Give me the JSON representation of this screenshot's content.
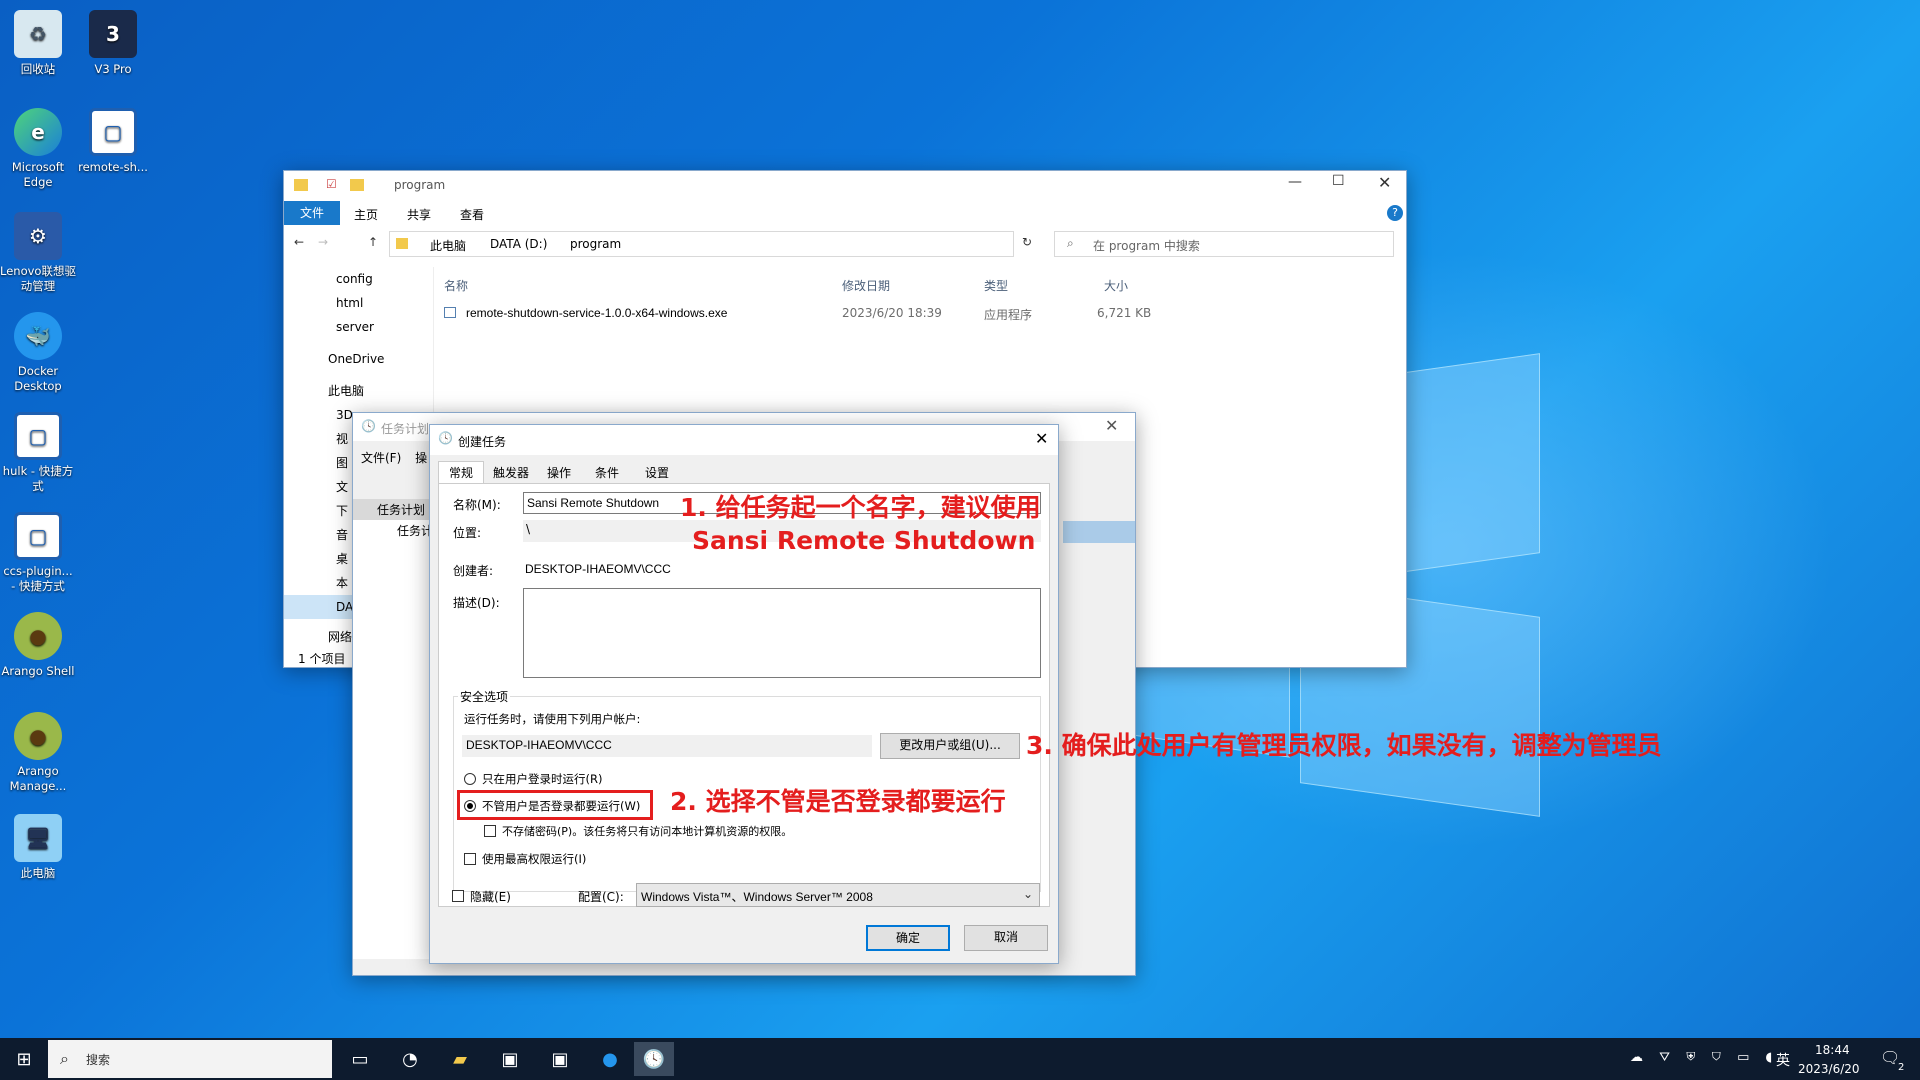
{
  "desktop": {
    "icons": [
      {
        "label": "回收站",
        "icon": "recycle-bin-icon"
      },
      {
        "label": "V3 Pro",
        "icon": "v3-pro-icon"
      },
      {
        "label": "Microsoft Edge",
        "icon": "edge-icon"
      },
      {
        "label": "remote-sh...",
        "icon": "app-icon"
      },
      {
        "label": "Lenovo联想驱动管理",
        "icon": "lenovo-driver-icon"
      },
      {
        "label": "Docker Desktop",
        "icon": "docker-icon"
      },
      {
        "label": "hulk - 快捷方式",
        "icon": "shortcut-icon"
      },
      {
        "label": "ccs-plugin... - 快捷方式",
        "icon": "shortcut-icon"
      },
      {
        "label": "Arango Shell",
        "icon": "avocado-icon"
      },
      {
        "label": "Arango Manage...",
        "icon": "avocado-icon"
      },
      {
        "label": "此电脑",
        "icon": "computer-icon"
      }
    ]
  },
  "explorer": {
    "title": "program",
    "ribbon_tabs": [
      "文件",
      "主页",
      "共享",
      "查看"
    ],
    "breadcrumb": [
      "此电脑",
      "DATA (D:)",
      "program"
    ],
    "search_placeholder": "在 program 中搜索",
    "sidebar": [
      "config",
      "html",
      "server",
      "OneDrive",
      "此电脑",
      "3D",
      "视",
      "图",
      "文",
      "下",
      "音",
      "桌",
      "本",
      "DA",
      "网络"
    ],
    "columns": [
      "名称",
      "修改日期",
      "类型",
      "大小"
    ],
    "rows": [
      {
        "name": "remote-shutdown-service-1.0.0-x64-windows.exe",
        "date": "2023/6/20 18:39",
        "type": "应用程序",
        "size": "6,721 KB"
      }
    ],
    "status": "1 个项目"
  },
  "scheduler": {
    "title": "任务计划",
    "menu": [
      "文件(F)",
      "操"
    ],
    "tree": [
      "任务计划",
      "任务计"
    ]
  },
  "dialog": {
    "title": "创建任务",
    "tabs": [
      "常规",
      "触发器",
      "操作",
      "条件",
      "设置"
    ],
    "name_label": "名称(M):",
    "name_value": "Sansi Remote Shutdown",
    "location_label": "位置:",
    "location_value": "\\",
    "author_label": "创建者:",
    "author_value": "DESKTOP-IHAEOMV\\CCC",
    "desc_label": "描述(D):",
    "security_group": "安全选项",
    "run_as_text": "运行任务时，请使用下列用户帐户:",
    "user_value": "DESKTOP-IHAEOMV\\CCC",
    "change_user_btn": "更改用户或组(U)...",
    "radio_logged_on": "只在用户登录时运行(R)",
    "radio_whether": "不管用户是否登录都要运行(W)",
    "no_store_pw": "不存储密码(P)。该任务将只有访问本地计算机资源的权限。",
    "highest_priv": "使用最高权限运行(I)",
    "hidden": "隐藏(E)",
    "config_label": "配置(C):",
    "config_value": "Windows Vista™、Windows Server™ 2008",
    "ok": "确定",
    "cancel": "取消"
  },
  "annotations": {
    "a1": "1. 给任务起一个名字，建议使用",
    "a1b": "Sansi Remote Shutdown",
    "a2": "2. 选择不管是否登录都要运行",
    "a3": "3. 确保此处用户有管理员权限，如果没有，调整为管理员",
    "color": "#e41e1e"
  },
  "taskbar": {
    "search": "搜索",
    "ime": "英",
    "time": "18:44",
    "date": "2023/6/20",
    "notify_count": "2"
  }
}
